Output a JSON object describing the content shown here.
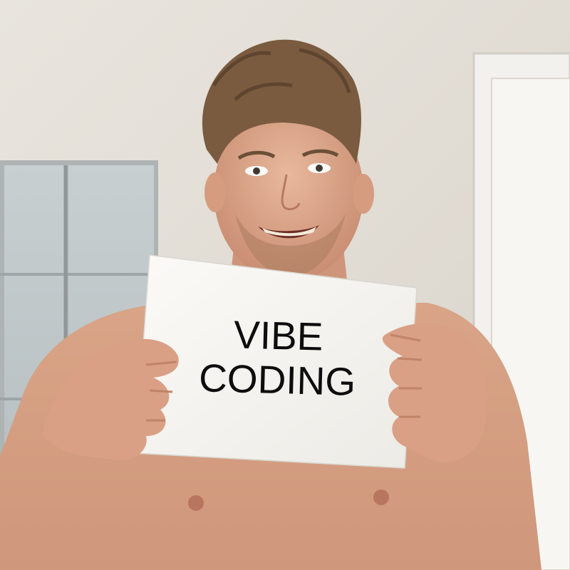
{
  "sign": {
    "line1": "VIBE",
    "line2": "CODING"
  },
  "colors": {
    "wall": "#e8e3dc",
    "door": "#f3f1ed",
    "glass_panel": "#c9d0d2",
    "skin": "#dca98e",
    "hair": "#7a5b3f",
    "paper": "#f6f5f1",
    "text": "#0d0d0d"
  }
}
